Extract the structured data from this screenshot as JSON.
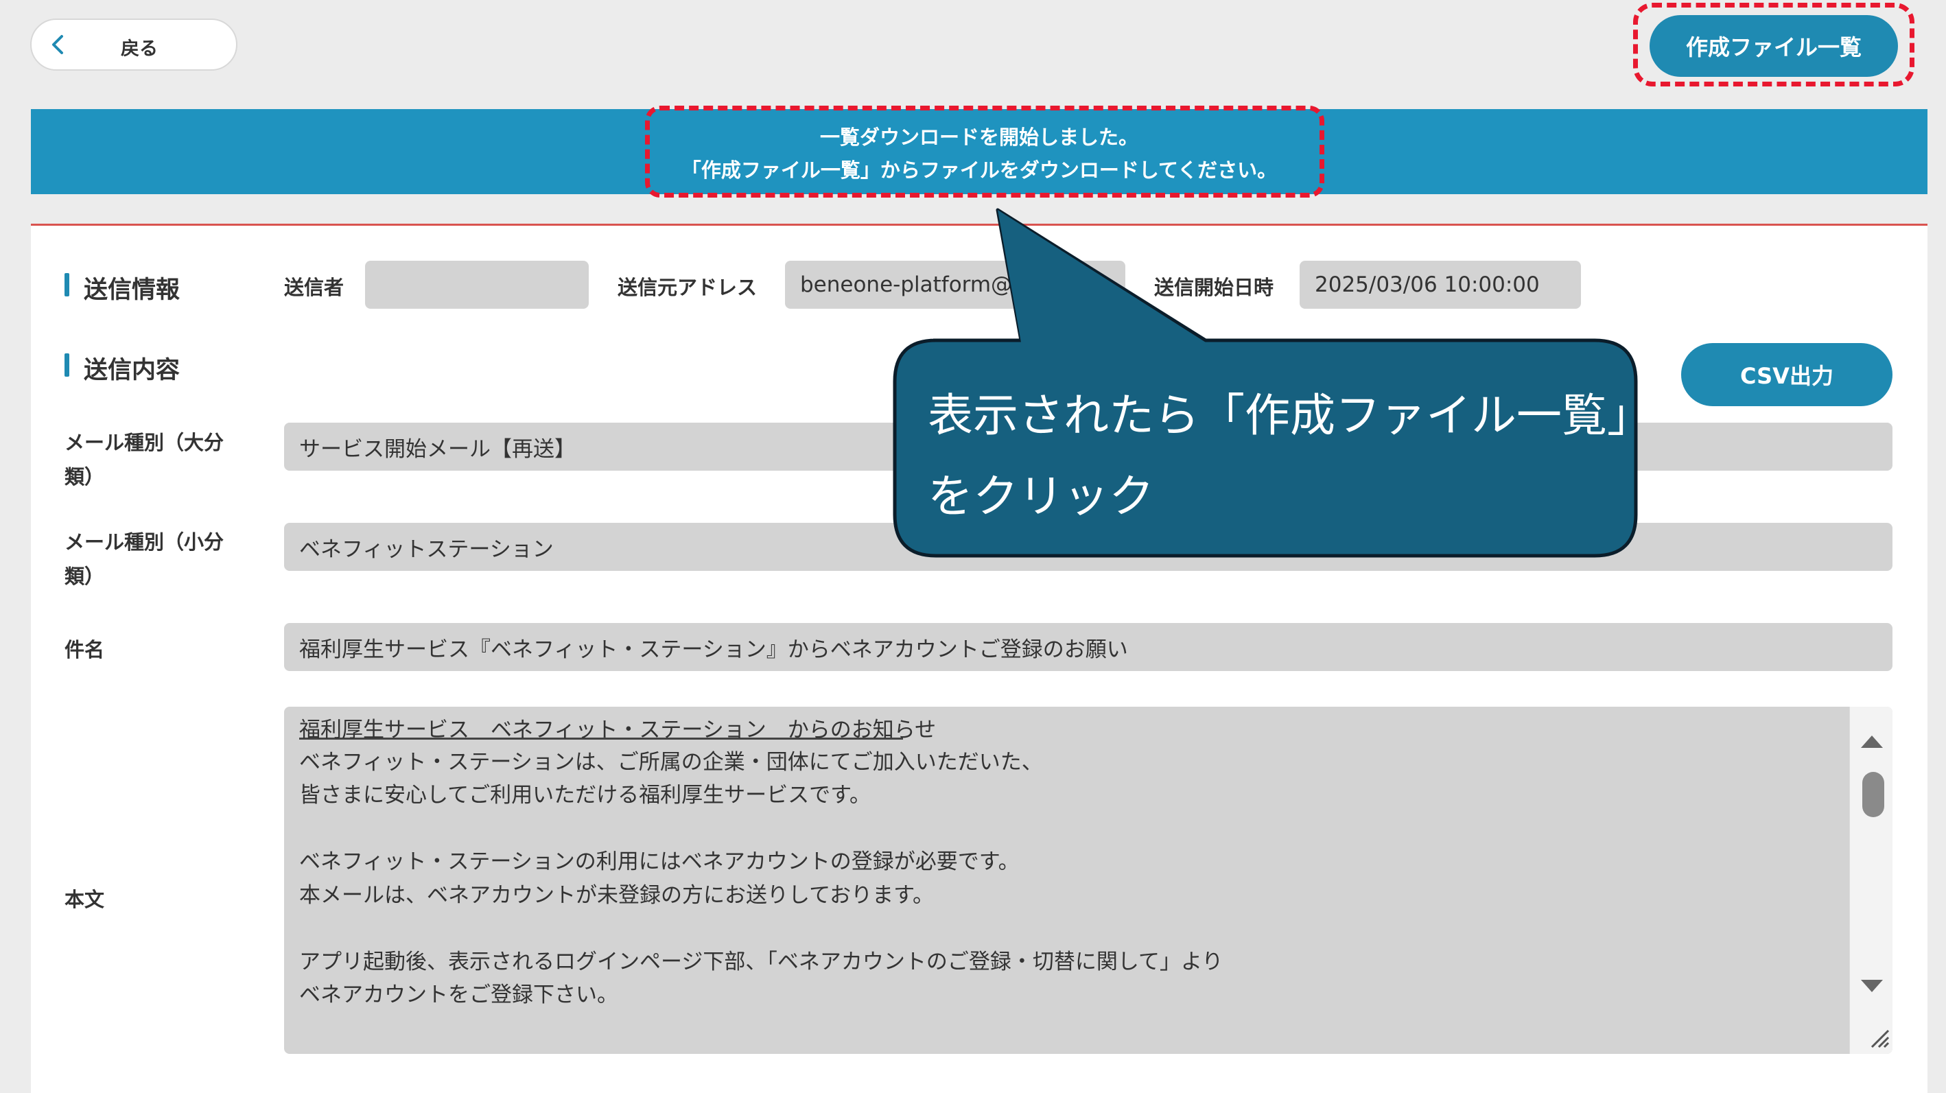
{
  "top": {
    "back_label": "戻る",
    "files_button_label": "作成ファイル一覧"
  },
  "banner": {
    "line1": "一覧ダウンロードを開始しました。",
    "line2": "「作成ファイル一覧」からファイルをダウンロードしてください。"
  },
  "send_info": {
    "title": "送信情報",
    "sender_label": "送信者",
    "sender_value": "",
    "from_label": "送信元アドレス",
    "from_value": "beneone-platform@",
    "start_label": "送信開始日時",
    "start_value": "2025/03/06 10:00:00"
  },
  "send_content": {
    "title": "送信内容",
    "csv_button_label": "CSV出力",
    "category_major_label_1": "メール種別（大分",
    "category_major_label_2": "類）",
    "category_major_value": "サービス開始メール【再送】",
    "category_minor_label_1": "メール種別（小分",
    "category_minor_label_2": "類）",
    "category_minor_value": "ベネフィットステーション",
    "subject_label": "件名",
    "subject_value": "福利厚生サービス『ベネフィット・ステーション』からベネアカウントご登録のお願い",
    "body_label": "本文",
    "body_lines": {
      "l1": "福利厚生サービス　ベネフィット・ステーション　からのお知らせ",
      "l3": "ベネフィット・ステーションは、ご所属の企業・団体にてご加入いただいた、",
      "l4": "皆さまに安心してご利用いただける福利厚生サービスです。",
      "l6": "ベネフィット・ステーションの利用にはベネアカウントの登録が必要です。",
      "l7": "本メールは、ベネアカウントが未登録の方にお送りしております。",
      "l9": "アプリ起動後、表示されるログインページ下部、「ベネアカウントのご登録・切替に関して」より",
      "l10": "ベネアカウントをご登録下さい。"
    }
  },
  "callout": {
    "line1": "表示されたら「作成ファイル一覧」",
    "line2": "をクリック"
  },
  "colors": {
    "accent": "#1f8ab2",
    "banner": "#1f93bf",
    "highlight": "#e8182f",
    "callout_fill": "#16607f"
  }
}
